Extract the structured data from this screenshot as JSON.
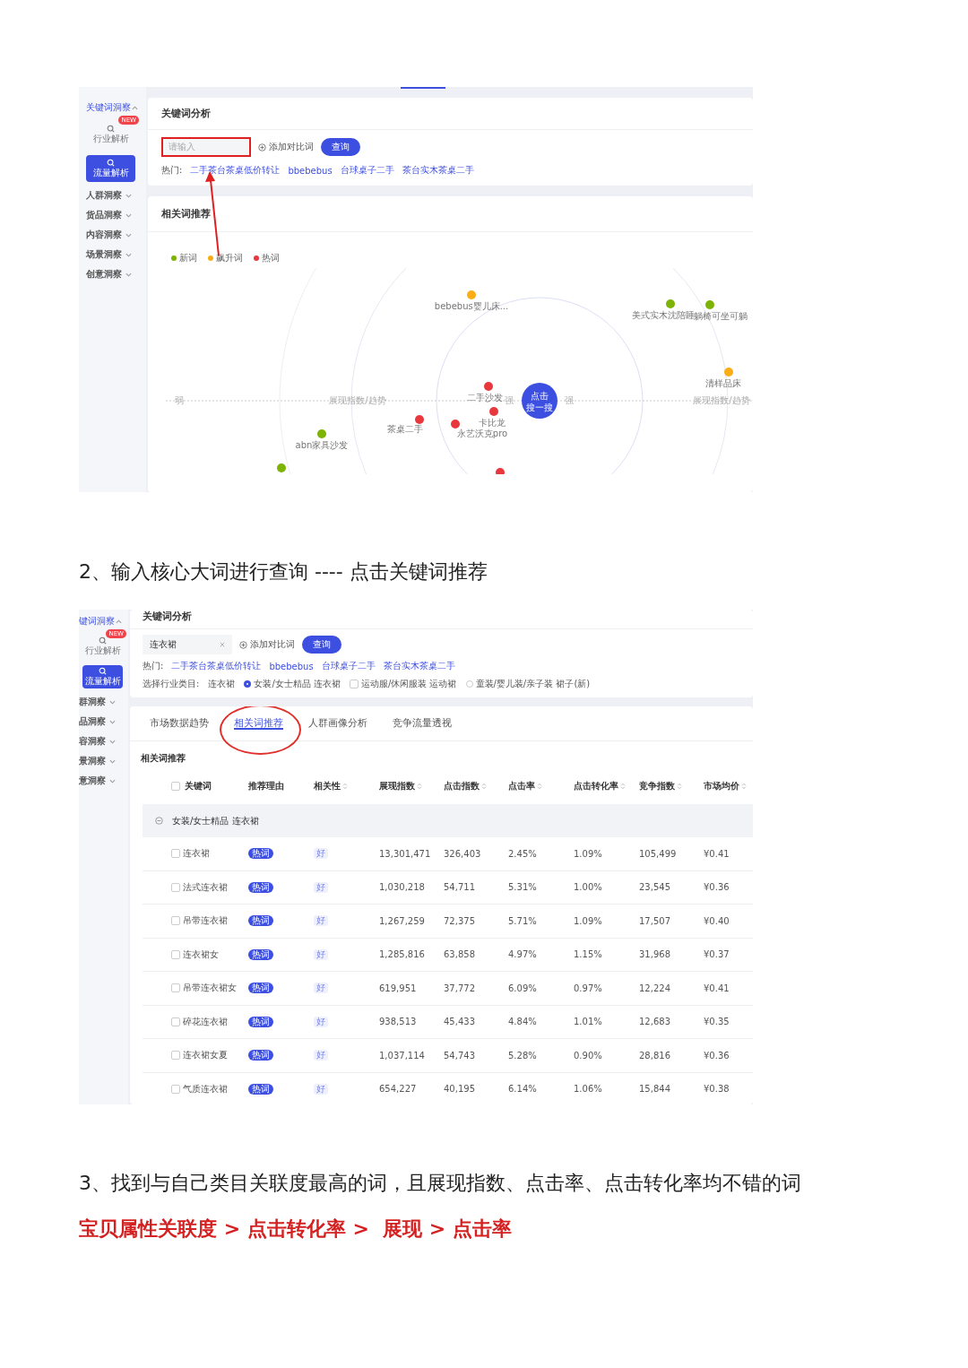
{
  "shot1": {
    "sidebar": {
      "section": {
        "label": "关键词洞察",
        "expanded": true
      },
      "badge": "NEW",
      "sub_items": [
        {
          "label": "行业解析",
          "selected": false
        },
        {
          "label": "流量解析",
          "selected": true
        }
      ],
      "groups": [
        {
          "label": "人群洞察",
          "expanded": false
        },
        {
          "label": "货品洞察",
          "expanded": false
        },
        {
          "label": "内容洞察",
          "expanded": false
        },
        {
          "label": "场景洞察",
          "expanded": false
        },
        {
          "label": "创意洞察",
          "expanded": false
        }
      ]
    },
    "search_card": {
      "title": "关键词分析",
      "search": {
        "placeholder": "请输入",
        "outlined": true
      },
      "compare": "添加对比词",
      "query_button": "查询",
      "hot_label": "热门:",
      "hot_links": [
        "二手茶台茶桌低价转让",
        "bbebebus",
        "台球桌子二手",
        "茶台实木茶桌二手"
      ]
    },
    "related_card": {
      "title": "相关词推荐",
      "legend": [
        {
          "label": "新词",
          "color": "#7cb305"
        },
        {
          "label": "飙升词",
          "color": "#faad14"
        },
        {
          "label": "热词",
          "color": "#e8383d"
        }
      ],
      "axis": {
        "left_end": "弱",
        "left_title": "展现指数/趋势",
        "left_inner": "强",
        "right_inner": "强",
        "right_title": "展现指数/趋势"
      },
      "center_button": [
        "点击",
        "搜一搜"
      ],
      "keywords": [
        {
          "label": "bebebus婴儿床...",
          "color": "#faad14"
        },
        {
          "label": "美式实木沈陪睡",
          "color": "#7cb305"
        },
        {
          "label": "躺椅可坐可躺",
          "color": "#7cb305"
        },
        {
          "label": "清样品床",
          "color": "#faad14"
        },
        {
          "label": "二手沙发",
          "color": "#e8383d"
        },
        {
          "label": "卡比龙",
          "color": "#e8383d"
        },
        {
          "label": "茶桌二手",
          "color": "#e8383d"
        },
        {
          "label": "永艺沃克pro",
          "color": "#e8383d"
        },
        {
          "label": "abn家具沙发",
          "color": "#7cb305"
        },
        {
          "color": "#7cb305"
        },
        {
          "color": "#e8383d"
        }
      ]
    }
  },
  "step2": "2、输入核心大词进行查询 ---- 点击关键词推荐",
  "shot2": {
    "sidebar": {
      "section": {
        "label": "键词洞察",
        "expanded": true
      },
      "badge": "NEW",
      "sub_items": [
        {
          "label": "行业解析",
          "selected": false
        },
        {
          "label": "流量解析",
          "selected": true
        }
      ],
      "groups": [
        {
          "label": "群洞察",
          "expanded": false
        },
        {
          "label": "品洞察",
          "expanded": false
        },
        {
          "label": "容洞察",
          "expanded": false
        },
        {
          "label": "景洞察",
          "expanded": false
        },
        {
          "label": "意洞察",
          "expanded": false
        }
      ]
    },
    "search_card": {
      "title": "关键词分析",
      "search": {
        "value": "连衣裙",
        "outlined": false
      },
      "compare": "添加对比词",
      "query_button": "查询",
      "hot_label": "热门:",
      "hot_links": [
        "二手茶台茶桌低价转让",
        "bbebebus",
        "台球桌子二手",
        "茶台实木茶桌二手"
      ],
      "category_label": "选择行业类目:",
      "category_options": [
        {
          "label": "连衣裙",
          "kind": "text"
        },
        {
          "label": "女装/女士精品 连衣裙",
          "kind": "radio",
          "selected": true
        },
        {
          "label": "运动服/休闲服装 运动裙",
          "kind": "checkbox",
          "selected": false
        },
        {
          "label": "童装/婴儿装/亲子装 裙子(新)",
          "kind": "radio",
          "selected": false
        }
      ]
    },
    "tabs": [
      {
        "label": "市场数据趋势",
        "selected": false,
        "circled": false
      },
      {
        "label": "相关词推荐",
        "selected": true,
        "circled": true
      },
      {
        "label": "人群画像分析",
        "selected": false,
        "circled": false
      },
      {
        "label": "竞争流量透视",
        "selected": false,
        "circled": false
      }
    ],
    "table_title": "相关词推荐",
    "table": {
      "header_checked": false,
      "columns": [
        {
          "label": "关键词",
          "kind": "keyword",
          "sortable": false
        },
        {
          "label": "推荐理由",
          "kind": "badge",
          "sortable": false
        },
        {
          "label": "相关性",
          "kind": "tag",
          "sortable": true
        },
        {
          "label": "展现指数",
          "kind": "text",
          "sortable": true
        },
        {
          "label": "点击指数",
          "kind": "text",
          "sortable": true
        },
        {
          "label": "点击率",
          "kind": "text",
          "sortable": true
        },
        {
          "label": "点击转化率",
          "kind": "text",
          "sortable": true
        },
        {
          "label": "竞争指数",
          "kind": "text",
          "sortable": true
        },
        {
          "label": "市场均价",
          "kind": "text",
          "sortable": true
        }
      ],
      "group": {
        "label": "女装/女士精品 连衣裙",
        "expanded": true
      },
      "rows": [
        {
          "checked": false,
          "cells": [
            "连衣裙",
            "热词",
            "好",
            "13,301,471",
            "326,403",
            "2.45%",
            "1.09%",
            "105,499",
            "¥0.41"
          ]
        },
        {
          "checked": false,
          "cells": [
            "法式连衣裙",
            "热词",
            "好",
            "1,030,218",
            "54,711",
            "5.31%",
            "1.00%",
            "23,545",
            "¥0.36"
          ]
        },
        {
          "checked": false,
          "cells": [
            "吊带连衣裙",
            "热词",
            "好",
            "1,267,259",
            "72,375",
            "5.71%",
            "1.09%",
            "17,507",
            "¥0.40"
          ]
        },
        {
          "checked": false,
          "cells": [
            "连衣裙女",
            "热词",
            "好",
            "1,285,816",
            "63,858",
            "4.97%",
            "1.15%",
            "31,968",
            "¥0.37"
          ]
        },
        {
          "checked": false,
          "cells": [
            "吊带连衣裙女",
            "热词",
            "好",
            "619,951",
            "37,772",
            "6.09%",
            "0.97%",
            "12,224",
            "¥0.41"
          ]
        },
        {
          "checked": false,
          "cells": [
            "碎花连衣裙",
            "热词",
            "好",
            "938,513",
            "45,433",
            "4.84%",
            "1.01%",
            "12,683",
            "¥0.35"
          ]
        },
        {
          "checked": false,
          "cells": [
            "连衣裙女夏",
            "热词",
            "好",
            "1,037,114",
            "54,743",
            "5.28%",
            "0.90%",
            "28,816",
            "¥0.36"
          ]
        },
        {
          "checked": false,
          "cells": [
            "气质连衣裙",
            "热词",
            "好",
            "654,227",
            "40,195",
            "6.14%",
            "1.06%",
            "15,844",
            "¥0.38"
          ]
        }
      ]
    }
  },
  "step3": "3、找到与自己类目关联度最高的词，且展现指数、点击率、点击转化率均不错的词",
  "priority": "宝贝属性关联度 > 点击转化率 >  展现 > 点击率"
}
